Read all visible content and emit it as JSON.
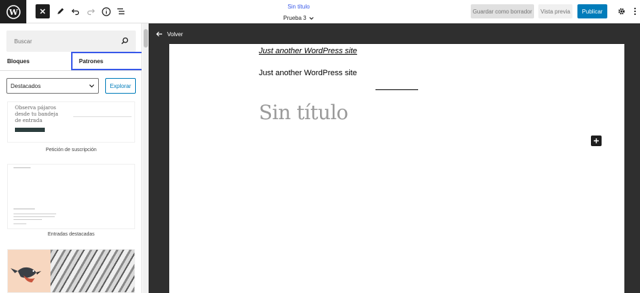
{
  "header": {
    "doc_title": "Sin título",
    "template_label": "Prueba 3",
    "save_draft_label": "Guardar como borrador",
    "preview_label": "Vista previa",
    "publish_label": "Publicar",
    "icons": [
      "wordpress-icon",
      "close-icon",
      "pencil-icon",
      "undo-icon",
      "redo-icon",
      "info-icon",
      "list-view-icon",
      "chevron-down-icon",
      "gear-icon",
      "more-vertical-icon"
    ],
    "colors": {
      "accent": "#3858e9",
      "publish": "#007cba",
      "dark": "#1e1e1e"
    }
  },
  "sidebar": {
    "search_placeholder": "Buscar",
    "tabs": [
      {
        "label": "Bloques",
        "active": false
      },
      {
        "label": "Patrones",
        "active": true
      }
    ],
    "category_selected": "Destacados",
    "explore_label": "Explorar",
    "patterns": [
      {
        "caption": "Petición de suscripción",
        "preview_text": "Observa pájaros desde tu bandeja de entrada"
      },
      {
        "caption": "Entradas destacadas"
      },
      {
        "caption": ""
      }
    ]
  },
  "canvas": {
    "back_label": "Volver",
    "site_title": "Just another WordPress site",
    "site_tagline": "Just another WordPress site",
    "post_title_placeholder": "Sin título"
  }
}
